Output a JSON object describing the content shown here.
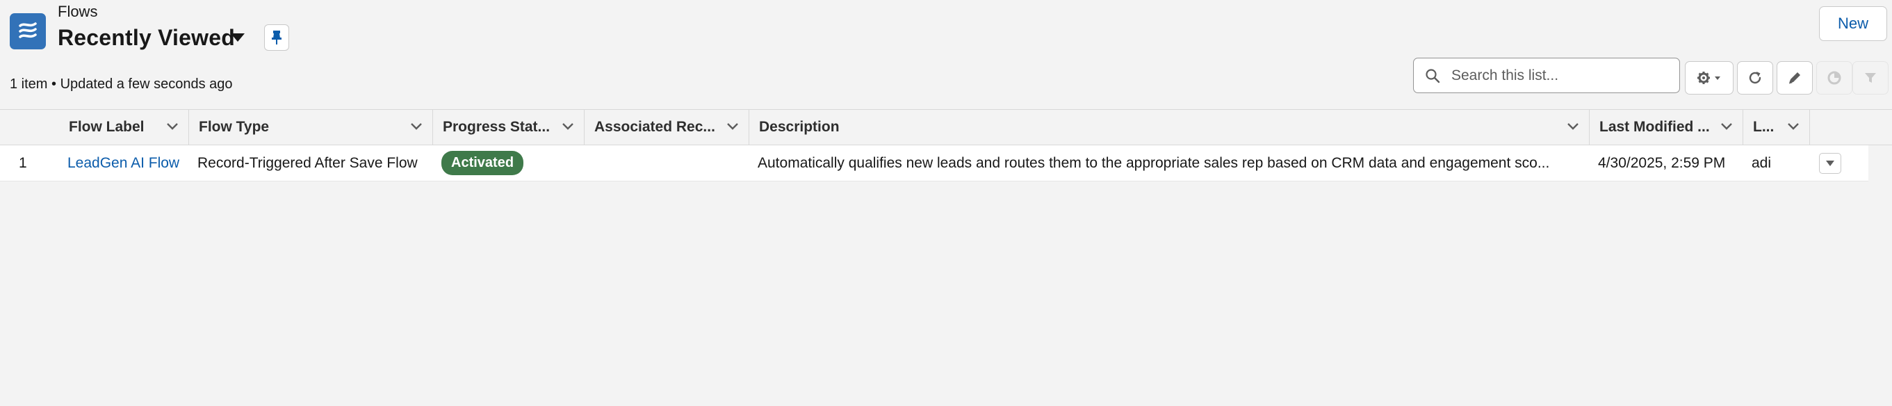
{
  "header": {
    "object_name": "Flows",
    "list_view_title": "Recently Viewed",
    "new_button_label": "New",
    "meta": "1 item • Updated a few seconds ago"
  },
  "search": {
    "placeholder": "Search this list..."
  },
  "icons": {
    "app": "flow-icon",
    "view_switch": "chevron-down-icon",
    "pin": "pin-icon",
    "search": "search-icon",
    "settings": "gear-icon",
    "refresh": "refresh-icon",
    "edit": "pencil-icon",
    "chart": "chart-icon",
    "filter": "filter-icon"
  },
  "table": {
    "columns": [
      {
        "label": "Flow Label"
      },
      {
        "label": "Flow Type"
      },
      {
        "label": "Progress Stat..."
      },
      {
        "label": "Associated Rec..."
      },
      {
        "label": "Description"
      },
      {
        "label": "Last Modified ..."
      },
      {
        "label": "L..."
      }
    ],
    "rows": [
      {
        "number": "1",
        "flow_label": "LeadGen AI Flow",
        "flow_type": "Record-Triggered After Save Flow",
        "progress_status": "Activated",
        "associated_record": "",
        "description": "Automatically qualifies new leads and routes them to the appropriate sales rep based on CRM data and engagement sco...",
        "last_modified": "4/30/2025, 2:59 PM",
        "last_modified_by": "adi"
      }
    ]
  },
  "colors": {
    "brand_icon": "#3272b8",
    "link": "#0b5cab",
    "activated_badge": "#3f7a4a",
    "page_background": "#f3f3f3"
  }
}
